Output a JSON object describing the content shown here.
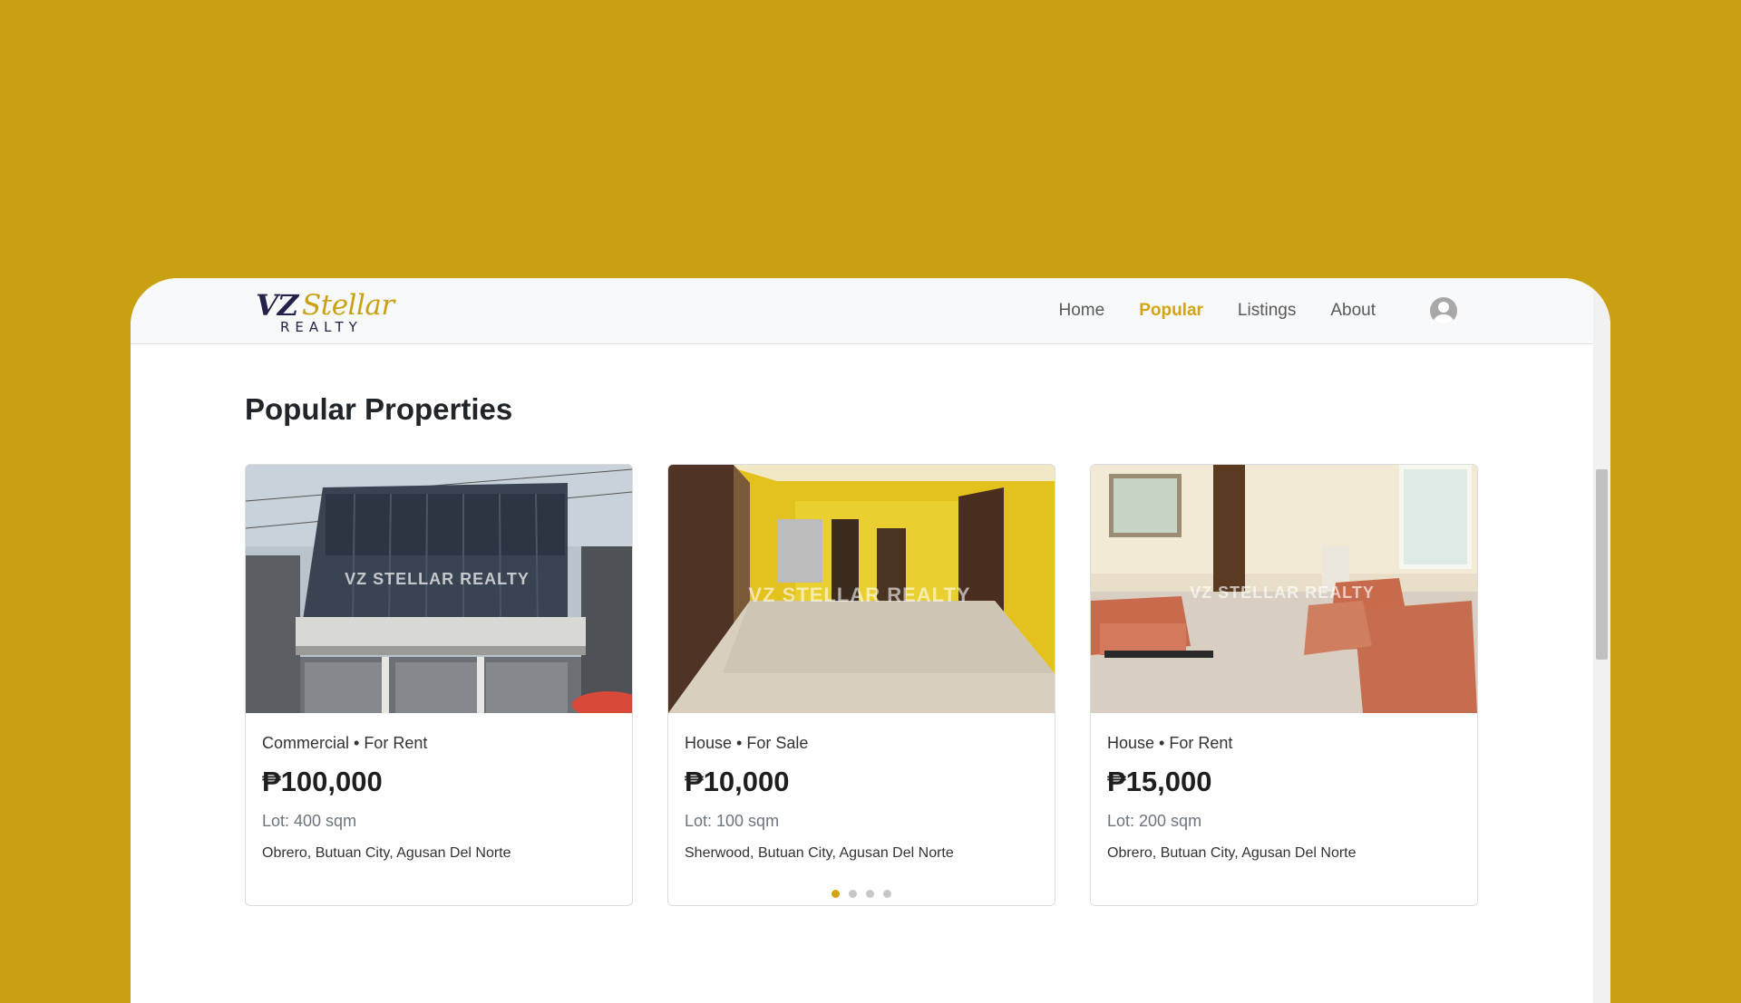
{
  "brand": {
    "logo_main": "VZ",
    "logo_accent": "Stellar",
    "logo_sub": "REALTY"
  },
  "nav": {
    "items": [
      {
        "label": "Home",
        "active": false
      },
      {
        "label": "Popular",
        "active": true
      },
      {
        "label": "Listings",
        "active": false
      },
      {
        "label": "About",
        "active": false
      }
    ],
    "profile_icon": "user-avatar-icon"
  },
  "main": {
    "section_title": "Popular Properties",
    "watermark": "VZ STELLAR REALTY",
    "cards": [
      {
        "type_status": "Commercial • For Rent",
        "price": "₱100,000",
        "lot": "Lot: 400 sqm",
        "location": "Obrero, Butuan City, Agusan Del Norte"
      },
      {
        "type_status": "House • For Sale",
        "price": "₱10,000",
        "lot": "Lot: 100 sqm",
        "location": "Sherwood, Butuan City, Agusan Del Norte",
        "carousel": {
          "total": 4,
          "active": 1
        }
      },
      {
        "type_status": "House • For Rent",
        "price": "₱15,000",
        "lot": "Lot: 200 sqm",
        "location": "Obrero, Butuan City, Agusan Del Norte"
      }
    ]
  },
  "colors": {
    "page_background": "#c9a011",
    "accent": "#d4a312",
    "navy": "#23224a"
  }
}
